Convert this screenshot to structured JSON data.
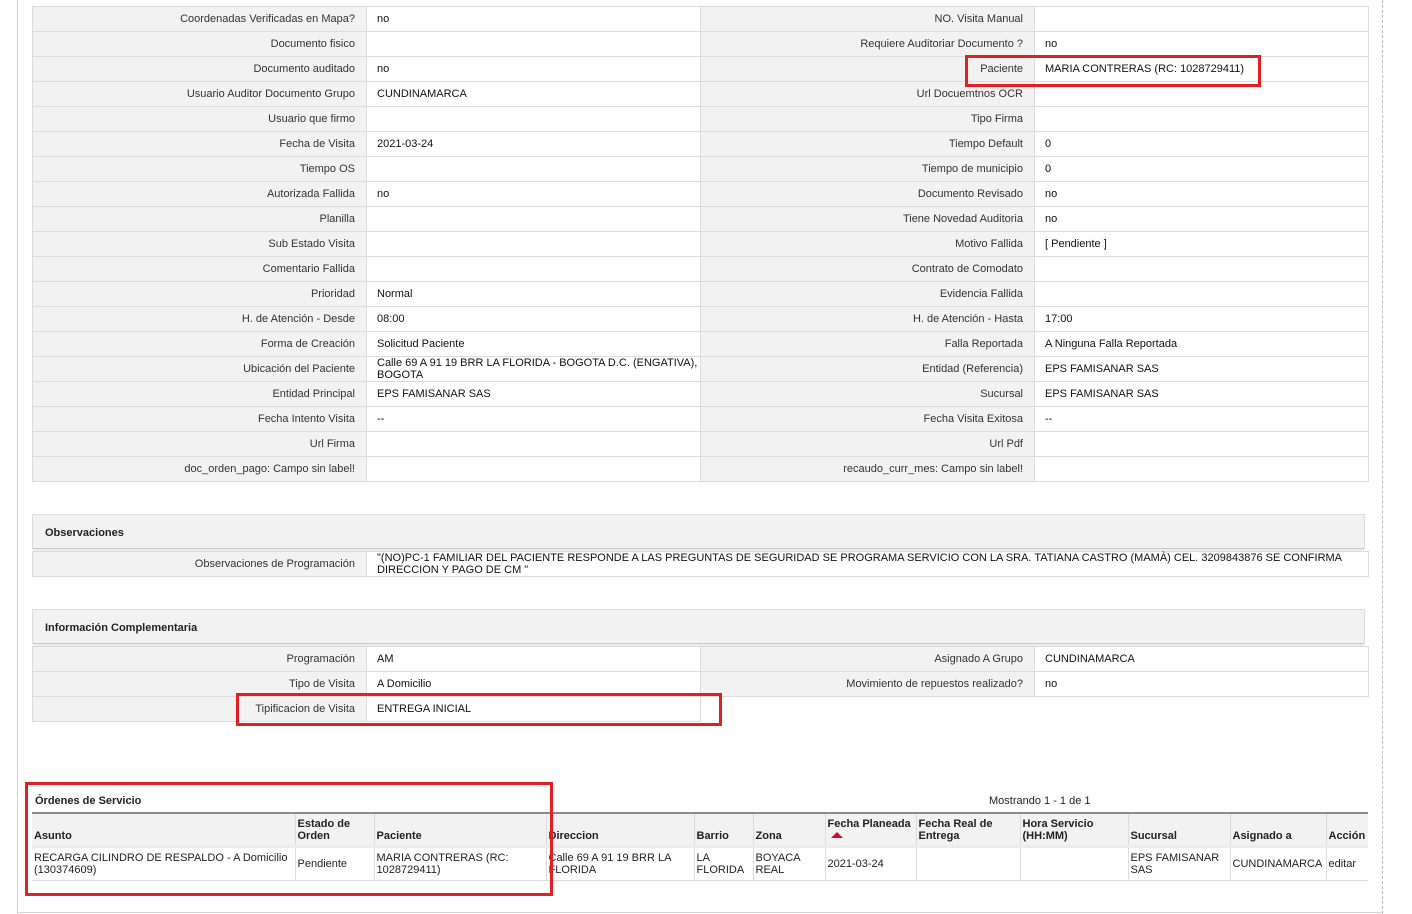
{
  "details": {
    "rows": [
      [
        {
          "label": "Coordenadas Verificadas en Mapa?",
          "value": "no"
        },
        {
          "label": "NO. Visita Manual",
          "value": ""
        }
      ],
      [
        {
          "label": "Documento fisico",
          "value": ""
        },
        {
          "label": "Requiere Auditoriar Documento ?",
          "value": "no"
        }
      ],
      [
        {
          "label": "Documento auditado",
          "value": "no"
        },
        {
          "label": "Paciente",
          "value": "MARIA CONTRERAS (RC: 1028729411)"
        }
      ],
      [
        {
          "label": "Usuario Auditor Documento Grupo",
          "value": "CUNDINAMARCA"
        },
        {
          "label": "Url Docuemtnos OCR",
          "value": ""
        }
      ],
      [
        {
          "label": "Usuario que firmo",
          "value": ""
        },
        {
          "label": "Tipo Firma",
          "value": ""
        }
      ],
      [
        {
          "label": "Fecha de Visita",
          "value": "2021-03-24"
        },
        {
          "label": "Tiempo Default",
          "value": "0"
        }
      ],
      [
        {
          "label": "Tiempo OS",
          "value": ""
        },
        {
          "label": "Tiempo de municipio",
          "value": "0"
        }
      ],
      [
        {
          "label": "Autorizada Fallida",
          "value": "no"
        },
        {
          "label": "Documento Revisado",
          "value": "no"
        }
      ],
      [
        {
          "label": "Planilla",
          "value": ""
        },
        {
          "label": "Tiene Novedad Auditoria",
          "value": "no"
        }
      ],
      [
        {
          "label": "Sub Estado Visita",
          "value": ""
        },
        {
          "label": "Motivo Fallida",
          "value": "[ Pendiente ]"
        }
      ],
      [
        {
          "label": "Comentario Fallida",
          "value": ""
        },
        {
          "label": "Contrato de Comodato",
          "value": ""
        }
      ],
      [
        {
          "label": "Prioridad",
          "value": "Normal"
        },
        {
          "label": "Evidencia Fallida",
          "value": ""
        }
      ],
      [
        {
          "label": "H. de Atención - Desde",
          "value": "08:00"
        },
        {
          "label": "H. de Atención - Hasta",
          "value": "17:00"
        }
      ],
      [
        {
          "label": "Forma de Creación",
          "value": "Solicitud Paciente"
        },
        {
          "label": "Falla Reportada",
          "value": "A Ninguna Falla Reportada"
        }
      ],
      [
        {
          "label": "Ubicación del Paciente",
          "value": "Calle 69 A 91 19 BRR LA FLORIDA - BOGOTA D.C. (ENGATIVA), BOGOTA"
        },
        {
          "label": "Entidad (Referencia)",
          "value": "EPS FAMISANAR SAS"
        }
      ],
      [
        {
          "label": "Entidad Principal",
          "value": "EPS FAMISANAR SAS"
        },
        {
          "label": "Sucursal",
          "value": "EPS FAMISANAR SAS"
        }
      ],
      [
        {
          "label": "Fecha Intento Visita",
          "value": "--"
        },
        {
          "label": "Fecha Visita Exitosa",
          "value": "--"
        }
      ],
      [
        {
          "label": "Url Firma",
          "value": ""
        },
        {
          "label": "Url Pdf",
          "value": ""
        }
      ],
      [
        {
          "label": "doc_orden_pago: Campo sin label!",
          "value": ""
        },
        {
          "label": "recaudo_curr_mes: Campo sin label!",
          "value": ""
        }
      ]
    ]
  },
  "observaciones": {
    "title": "Observaciones",
    "label": "Observaciones de Programación",
    "value": "\"(NO)PC-1 FAMILIAR DEL PACIENTE RESPONDE A LAS PREGUNTAS DE SEGURIDAD SE PROGRAMA SERVICIO CON LA SRA. TATIANA CASTRO (MAMÀ) CEL. 3209843876 SE CONFIRMA DIRECCION Y PAGO DE CM \""
  },
  "complementaria": {
    "title": "Información Complementaria",
    "rows": [
      [
        {
          "label": "Programación",
          "value": "AM"
        },
        {
          "label": "Asignado A Grupo",
          "value": "CUNDINAMARCA"
        }
      ],
      [
        {
          "label": "Tipo de Visita",
          "value": "A Domicilio"
        },
        {
          "label": "Movimiento de repuestos realizado?",
          "value": "no"
        }
      ],
      [
        {
          "label": "Tipificacion de Visita",
          "value": "ENTREGA INICIAL"
        }
      ]
    ]
  },
  "ordenes": {
    "title": "Órdenes de Servicio",
    "showing": "Mostrando 1 - 1 de 1",
    "columns": [
      "Asunto",
      "Estado de Orden",
      "Paciente",
      "Direccion",
      "Barrio",
      "Zona",
      "Fecha Planeada",
      "Fecha Real de Entrega",
      "Hora Servicio (HH:MM)",
      "Sucursal",
      "Asignado a",
      "Acción"
    ],
    "rows": [
      {
        "asunto": "RECARGA CILINDRO DE RESPALDO - A Domicilio (130374609)",
        "estado": "Pendiente",
        "paciente": "MARIA CONTRERAS (RC: 1028729411)",
        "direccion": "Calle 69 A 91 19 BRR LA FLORIDA",
        "barrio": "LA FLORIDA",
        "zona": "BOYACA REAL",
        "fecha_planeada": "2021-03-24",
        "fecha_real": "",
        "hora_servicio": "",
        "sucursal": "EPS FAMISANAR SAS",
        "asignado": "CUNDINAMARCA",
        "accion": "editar"
      }
    ]
  },
  "colors": {
    "highlight": "#e31e24",
    "label_bg": "#f2f2f2",
    "border": "#dcdcdc",
    "sort_arrow": "#c8102e"
  }
}
